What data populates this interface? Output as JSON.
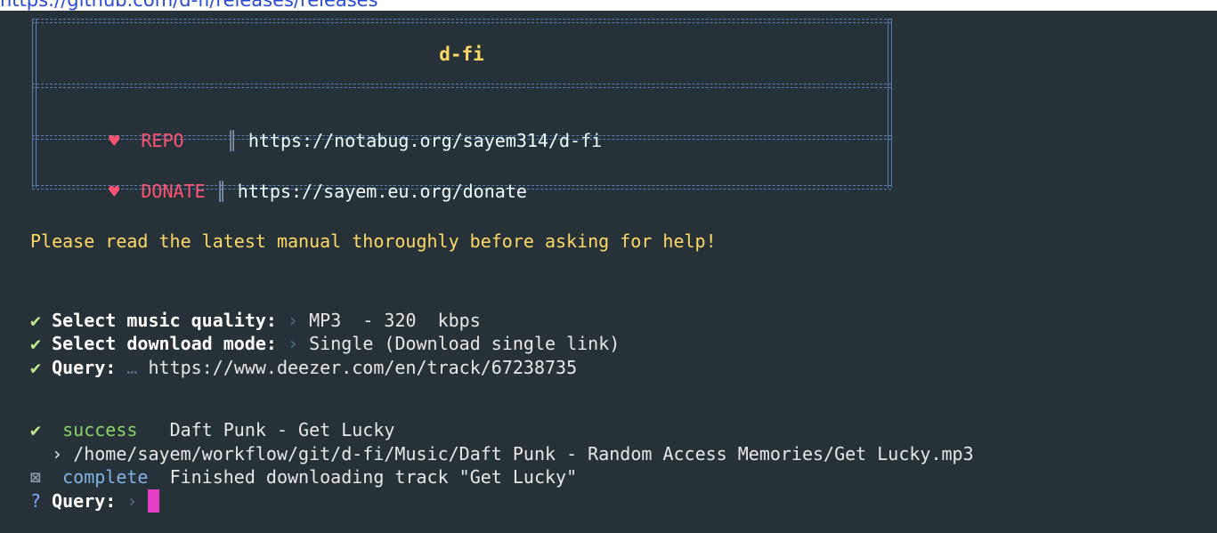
{
  "browser_link": {
    "text": "https://github.com/d-fi/releases/releases"
  },
  "banner": {
    "title": "d-fi",
    "rows": [
      {
        "icon": "heart-icon",
        "label": "REPO  ",
        "separator": "║",
        "value": "https://notabug.org/sayem314/d-fi"
      },
      {
        "icon": "heart-icon",
        "label": "DONATE",
        "separator": "║",
        "value": "https://sayem.eu.org/donate"
      }
    ]
  },
  "notice": "Please read the latest manual thoroughly before asking for help!",
  "prompts": [
    {
      "mark": "✔",
      "label": "Select music quality:",
      "arrow": "›",
      "value": "MP3  - 320  kbps"
    },
    {
      "mark": "✔",
      "label": "Select download mode:",
      "arrow": "›",
      "value": "Single (Download single link)"
    },
    {
      "mark": "✔",
      "label": "Query:",
      "arrow": "…",
      "value": "https://www.deezer.com/en/track/67238735"
    }
  ],
  "result": {
    "success_mark": "✔",
    "success_word": "success",
    "success_text": "Daft Punk - Get Lucky",
    "path_arrow": "›",
    "path": "/home/sayem/workflow/git/d-fi/Music/Daft Punk - Random Access Memories/Get Lucky.mp3",
    "complete_mark": "⊠",
    "complete_word": "complete",
    "complete_text": "Finished downloading track \"Get Lucky\""
  },
  "current_prompt": {
    "mark": "?",
    "label": "Query:",
    "arrow": "›",
    "input_value": ""
  },
  "colors": {
    "terminal_background": "#263238",
    "banner_border": "#5b7fb8",
    "title": "#ffd866",
    "heart": "#ff5370",
    "success": "#8bd46a",
    "complete": "#7fb3e6",
    "cursor": "#e540c9"
  }
}
